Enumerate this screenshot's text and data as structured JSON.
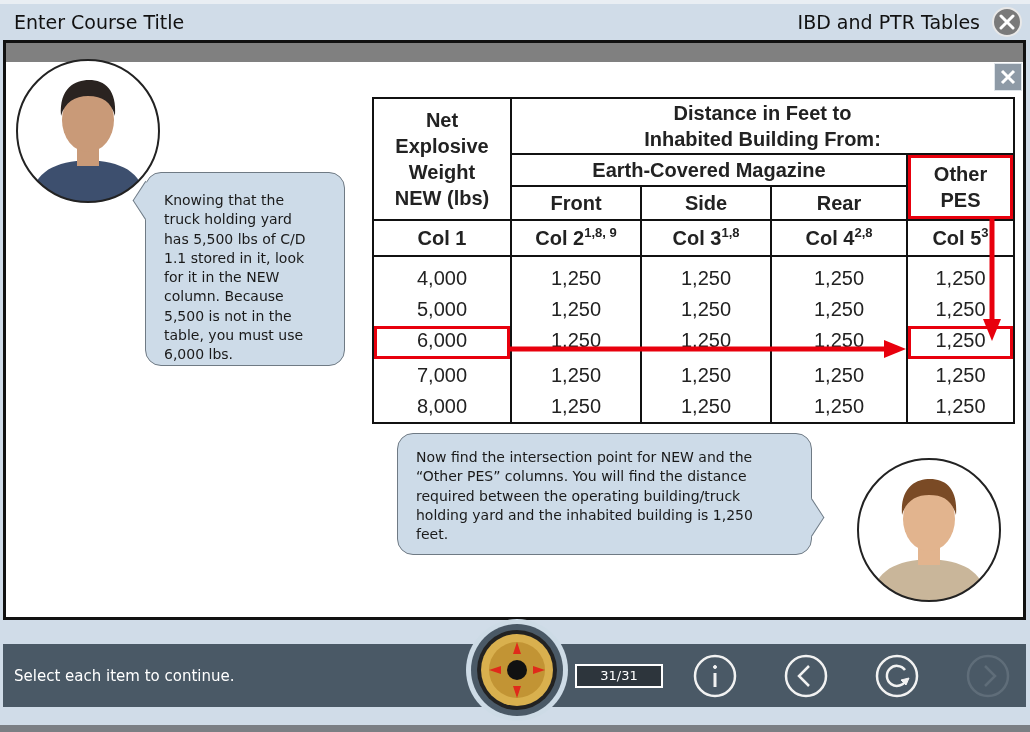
{
  "header": {
    "course_title": "Enter Course Title",
    "page_title": "IBD and PTR Tables"
  },
  "table": {
    "weight_heading": "Net Explosive Weight NEW (lbs)",
    "distance_heading": "Distance in Feet to Inhabited Building From:",
    "group_heading": "Earth-Covered Magazine",
    "other_heading": "Other PES",
    "other_highlighted": true,
    "subheads": [
      "Front",
      "Side",
      "Rear"
    ],
    "column_labels": [
      "Col 1",
      "Col 2$^{1,8, 9}$",
      "Col 3$^{1,8}$",
      "Col 4$^{2,8}$",
      "Col 5$^{3}$"
    ],
    "rows": [
      {
        "cells": [
          "4,000",
          "1,250",
          "1,250",
          "1,250",
          "1,250"
        ],
        "highlighted": false
      },
      {
        "cells": [
          "5,000",
          "1,250",
          "1,250",
          "1,250",
          "1,250"
        ],
        "highlighted": false
      },
      {
        "cells": [
          "6,000",
          "1,250",
          "1,250",
          "1,250",
          "1,250"
        ],
        "highlighted": true
      },
      {
        "cells": [
          "7,000",
          "1,250",
          "1,250",
          "1,250",
          "1,250"
        ],
        "highlighted": false
      },
      {
        "cells": [
          "8,000",
          "1,250",
          "1,250",
          "1,250",
          "1,250"
        ],
        "highlighted": false
      }
    ]
  },
  "bubbles": [
    {
      "kind": "left",
      "text": "Knowing that the truck holding yard has 5,500 lbs of C/D 1.1 stored in it, look for it in the NEW column. Because 5,500 is not in the table, you must use 6,000 lbs."
    },
    {
      "kind": "right",
      "text": "Now find the intersection point for NEW and the “Other PES” columns. You will find the distance required between the operating building/truck holding yard and the inhabited building is 1,250 feet."
    }
  ],
  "footer": {
    "instruction": "Select each item to continue.",
    "page_counter": "31/31",
    "buttons": [
      {
        "kind": "info",
        "disabled": false
      },
      {
        "kind": "back",
        "disabled": false
      },
      {
        "kind": "replay",
        "disabled": false
      },
      {
        "kind": "next",
        "disabled": true
      }
    ]
  }
}
